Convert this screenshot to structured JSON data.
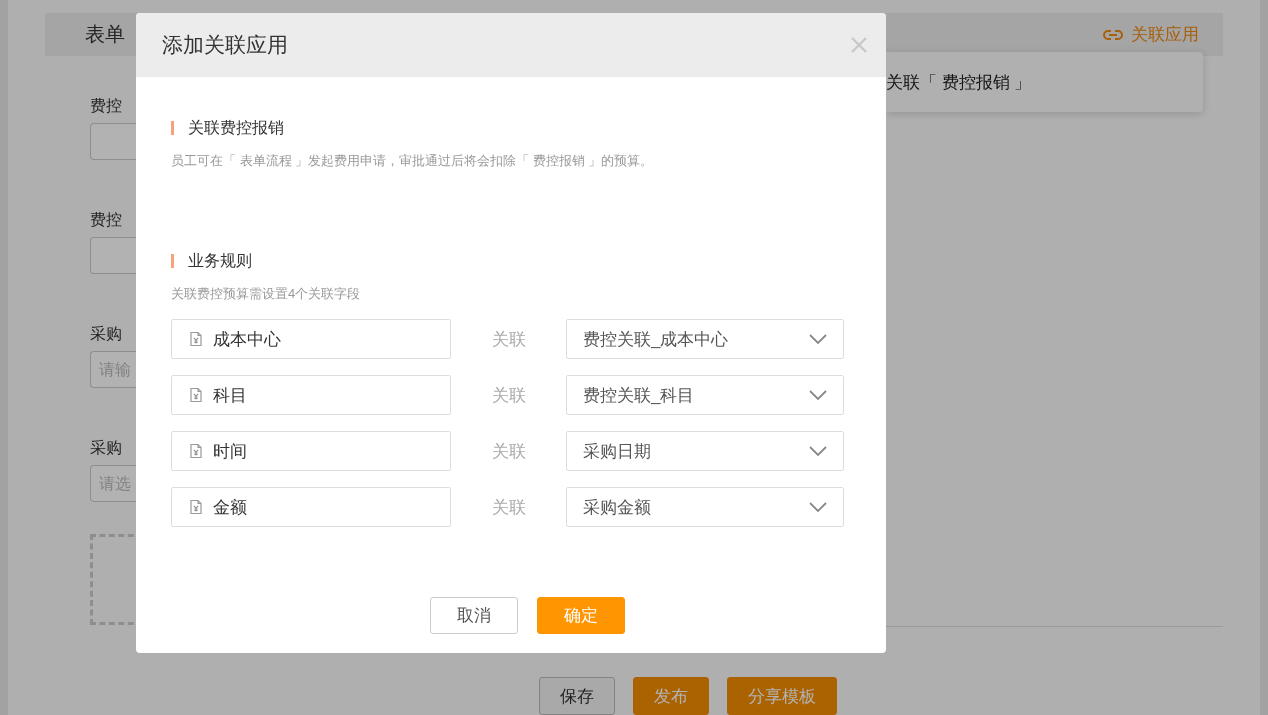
{
  "background": {
    "header": {
      "title": "表单",
      "link": "关联应用"
    },
    "fields": [
      {
        "label": "费控"
      },
      {
        "label": "费控"
      },
      {
        "label": "采购",
        "placeholder": "请输"
      },
      {
        "label": "采购",
        "placeholder": "请选"
      }
    ],
    "toast": "关联「 费控报销 」",
    "buttons": [
      {
        "label": "保存",
        "kind": "default"
      },
      {
        "label": "发布",
        "kind": "primary"
      },
      {
        "label": "分享模板",
        "kind": "primary"
      }
    ]
  },
  "modal": {
    "title": "添加关联应用",
    "section": {
      "title": "关联费控报销",
      "description": "员工可在「 表单流程 」发起费用申请，审批通过后将会扣除「 费控报销 」的预算。"
    },
    "rules": {
      "title": "业务规则",
      "hint": "关联费控预算需设置4个关联字段",
      "rows": [
        {
          "field": "成本中心",
          "relation": "关联",
          "target": "费控关联_成本中心"
        },
        {
          "field": "科目",
          "relation": "关联",
          "target": "费控关联_科目"
        },
        {
          "field": "时间",
          "relation": "关联",
          "target": "采购日期"
        },
        {
          "field": "金额",
          "relation": "关联",
          "target": "采购金额"
        }
      ]
    },
    "buttons": [
      {
        "label": "取消",
        "kind": "default"
      },
      {
        "label": "确定",
        "kind": "primary"
      }
    ]
  }
}
